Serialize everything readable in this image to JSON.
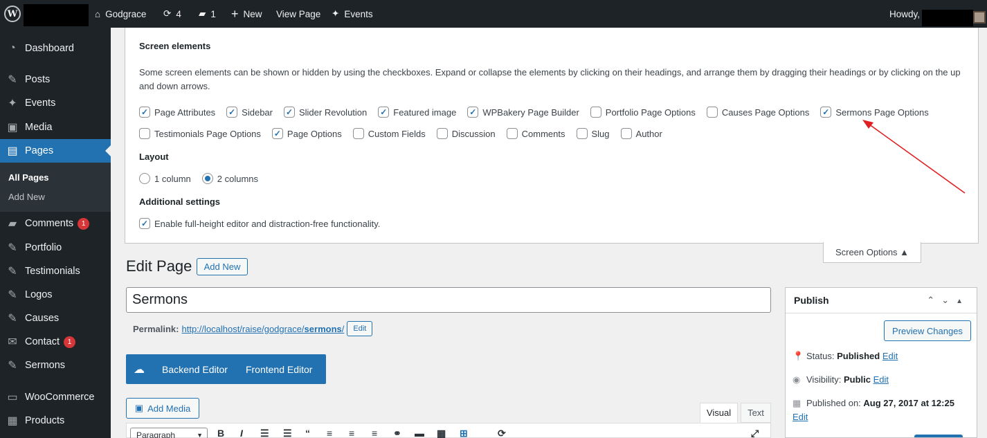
{
  "adminbar": {
    "site_name": "Godgrace",
    "updates_count": "4",
    "comments_count": "1",
    "new_label": "New",
    "view_page_label": "View Page",
    "events_label": "Events",
    "howdy_label": "Howdy,"
  },
  "sidebar": {
    "items": [
      {
        "label": "Dashboard",
        "icon": "dashboard-icon"
      },
      {
        "label": "Posts",
        "icon": "pin-icon"
      },
      {
        "label": "Events",
        "icon": "events-icon"
      },
      {
        "label": "Media",
        "icon": "media-icon"
      },
      {
        "label": "Pages",
        "icon": "pages-icon"
      },
      {
        "label": "Comments",
        "icon": "comments-icon",
        "badge": "1"
      },
      {
        "label": "Portfolio",
        "icon": "pin-icon"
      },
      {
        "label": "Testimonials",
        "icon": "pin-icon"
      },
      {
        "label": "Logos",
        "icon": "pin-icon"
      },
      {
        "label": "Causes",
        "icon": "pin-icon"
      },
      {
        "label": "Contact",
        "icon": "mail-icon",
        "badge": "1"
      },
      {
        "label": "Sermons",
        "icon": "pin-icon"
      },
      {
        "label": "WooCommerce",
        "icon": "woo-icon"
      },
      {
        "label": "Products",
        "icon": "products-icon"
      }
    ],
    "submenu": {
      "all_pages": "All Pages",
      "add_new": "Add New"
    }
  },
  "screen_options": {
    "heading": "Screen elements",
    "description": "Some screen elements can be shown or hidden by using the checkboxes. Expand or collapse the elements by clicking on their headings, and arrange them by dragging their headings or by clicking on the up and down arrows.",
    "row1": [
      {
        "label": "Page Attributes",
        "checked": true
      },
      {
        "label": "Sidebar",
        "checked": true
      },
      {
        "label": "Slider Revolution",
        "checked": true
      },
      {
        "label": "Featured image",
        "checked": true
      },
      {
        "label": "WPBakery Page Builder",
        "checked": true
      },
      {
        "label": "Portfolio Page Options",
        "checked": false
      },
      {
        "label": "Causes Page Options",
        "checked": false
      },
      {
        "label": "Sermons Page Options",
        "checked": true
      }
    ],
    "row2": [
      {
        "label": "Testimonials Page Options",
        "checked": false
      },
      {
        "label": "Page Options",
        "checked": true
      },
      {
        "label": "Custom Fields",
        "checked": false
      },
      {
        "label": "Discussion",
        "checked": false
      },
      {
        "label": "Comments",
        "checked": false
      },
      {
        "label": "Slug",
        "checked": false
      },
      {
        "label": "Author",
        "checked": false
      }
    ],
    "layout_heading": "Layout",
    "layout_1col": "1 column",
    "layout_2col": "2 columns",
    "layout_selected": "2 columns",
    "additional_heading": "Additional settings",
    "fullheight_label": "Enable full-height editor and distraction-free functionality.",
    "fullheight_checked": true,
    "tab_label": "Screen Options ▲"
  },
  "editor": {
    "page_title": "Edit Page",
    "add_new_label": "Add New",
    "title_value": "Sermons",
    "permalink_label": "Permalink:",
    "permalink_base": "http://localhost/raise/godgrace/",
    "permalink_slug": "sermons",
    "permalink_tail": "/",
    "permalink_edit": "Edit",
    "backend_editor": "Backend Editor",
    "frontend_editor": "Frontend Editor",
    "add_media": "Add Media",
    "tab_visual": "Visual",
    "tab_text": "Text",
    "format_select": "Paragraph"
  },
  "publish": {
    "title": "Publish",
    "preview_label": "Preview Changes",
    "status_label": "Status:",
    "status_value": "Published",
    "visibility_label": "Visibility:",
    "visibility_value": "Public",
    "published_on_label": "Published on:",
    "published_on_value": "Aug 27, 2017 at 12:25",
    "edit_label": "Edit"
  },
  "colors": {
    "adminbar_bg": "#1d2327",
    "accent": "#2271b1",
    "badge": "#d63638",
    "annotation_arrow": "#e02020"
  }
}
